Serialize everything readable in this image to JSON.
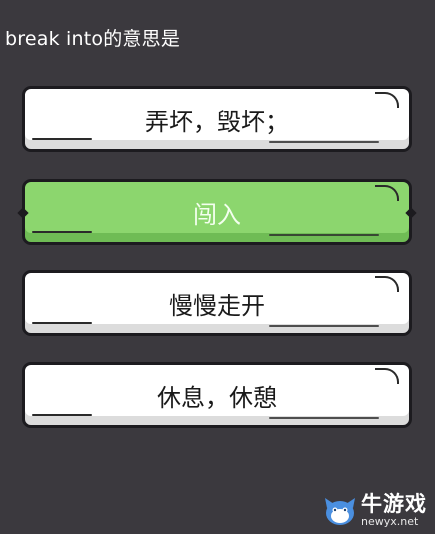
{
  "question": "break into的意思是",
  "options": [
    {
      "label": "弄坏，毁坏；",
      "selected": false
    },
    {
      "label": "闯入",
      "selected": true
    },
    {
      "label": "慢慢走开",
      "selected": false
    },
    {
      "label": "休息，休憩",
      "selected": false
    }
  ],
  "watermark": {
    "name": "牛游戏",
    "url": "newyx.net"
  },
  "colors": {
    "background": "#3b393e",
    "selected": "#8cd66e",
    "option": "#ffffff"
  }
}
